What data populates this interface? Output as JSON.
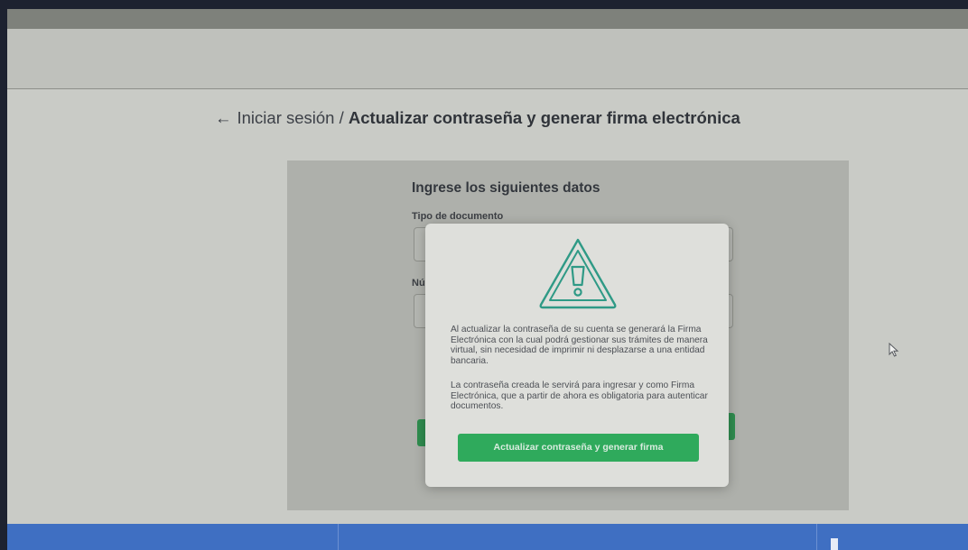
{
  "breadcrumb": {
    "back_arrow": "←",
    "back_label": "Iniciar sesión",
    "separator": "/",
    "current": "Actualizar contraseña y generar firma electrónica"
  },
  "form": {
    "title": "Ingrese los siguientes datos",
    "document_type_label": "Tipo de documento",
    "document_number_label_partial": "Nú"
  },
  "modal": {
    "icon": "warning-triangle-icon",
    "paragraph_1": "Al actualizar la contraseña de su cuenta se generará la Firma Electrónica con la cual podrá gestionar sus trámites de manera virtual, sin necesidad de imprimir ni desplazarse a una entidad bancaria.",
    "paragraph_2": "La contraseña creada le servirá para ingresar y como Firma Electrónica, que a partir de ahora es obligatoria para autenticar documentos.",
    "button_label": "Actualizar contraseña y generar firma"
  },
  "colors": {
    "accent_green": "#2faa5c",
    "icon_teal": "#2f9a86",
    "footer_blue": "#3f6fc2"
  }
}
